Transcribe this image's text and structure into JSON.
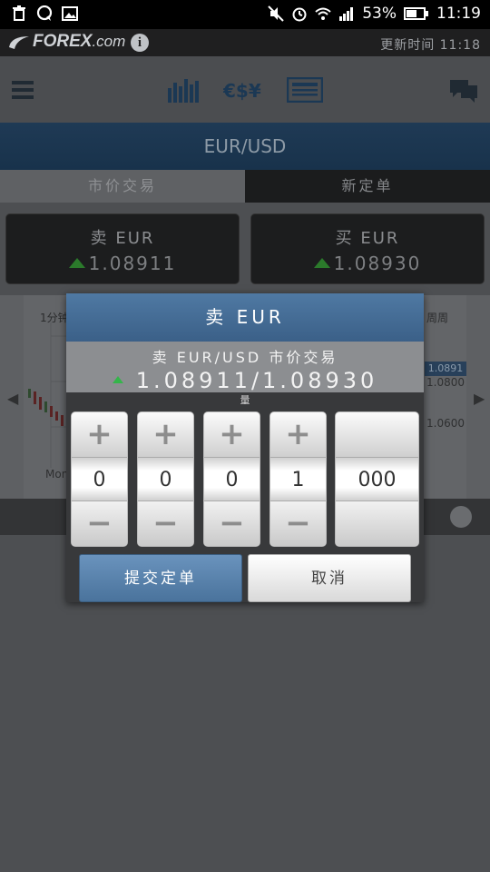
{
  "status_bar": {
    "battery": "53%",
    "time": "11:19",
    "icons": [
      "trash-icon",
      "chat-bubble-icon",
      "image-icon",
      "mute-icon",
      "alarm-icon",
      "wifi-icon",
      "signal-icon",
      "battery-icon"
    ]
  },
  "brand": {
    "logo_text": "FOREX",
    "logo_suffix": ".com",
    "update_time": "更新时间 11:18"
  },
  "toolbar": {
    "icons": [
      "menu-icon",
      "chart-bars-icon",
      "currency-icon",
      "news-icon",
      "chat-icon"
    ]
  },
  "pair": "EUR/USD",
  "tabs": [
    {
      "label": "市价交易",
      "active": true
    },
    {
      "label": "新定单",
      "active": false
    }
  ],
  "sell_box": {
    "label": "卖 EUR",
    "value": "1.08911"
  },
  "buy_box": {
    "label": "买 EUR",
    "value": "1.08930"
  },
  "chart": {
    "timeframe_left": "1分钟",
    "timeframe_right": "周周",
    "day_label": "Mon",
    "price_marker": "1.0891",
    "price_2": "1.0800",
    "price_3": "1.0600"
  },
  "dialog": {
    "title": "卖 EUR",
    "subtitle": "卖 EUR/USD 市价交易",
    "quote": "1.08911/1.08930",
    "quantity_label": "量",
    "digits": [
      "0",
      "0",
      "0",
      "1",
      "000"
    ],
    "plus": "+",
    "minus": "−",
    "submit_label": "提交定单",
    "cancel_label": "取消"
  },
  "colors": {
    "dialog_header": "#4f79a3",
    "submit_button": "#5b84ae",
    "up_green": "#34b54a"
  }
}
